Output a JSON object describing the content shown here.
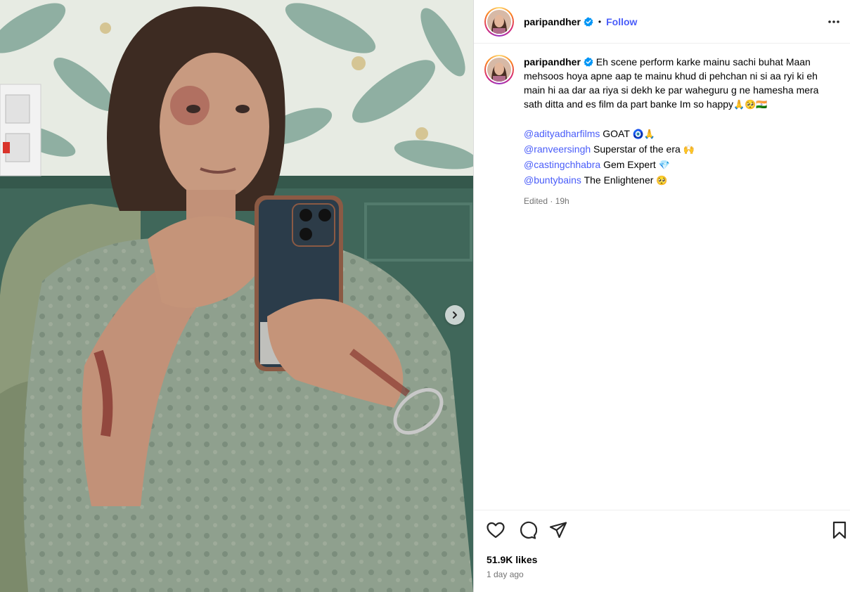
{
  "post": {
    "username": "paripandher",
    "follow_label": "Follow",
    "separator": "•",
    "caption_text": "Eh scene perform karke mainu sachi buhat Maan mehsoos hoya apne aap te mainu khud di pehchan ni si aa ryi ki eh main hi aa dar aa riya si dekh ke par waheguru g ne hamesha mera sath ditta and es film da part banke Im so happy",
    "caption_emoji": "🙏🥺🇮🇳",
    "mentions": [
      {
        "handle": "@adityadharfilms",
        "text": "GOAT",
        "emoji": "🧿🙏"
      },
      {
        "handle": "@ranveersingh",
        "text": "Superstar of the era",
        "emoji": "🙌"
      },
      {
        "handle": "@castingchhabra",
        "text": "Gem Expert",
        "emoji": "💎"
      },
      {
        "handle": "@buntybains",
        "text": "The Enlightener",
        "emoji": "🥺"
      }
    ],
    "meta": "Edited · 19h",
    "likes": "51.9K likes",
    "posted": "1 day ago"
  },
  "icons": {
    "verified": "verified-badge-icon",
    "more": "more-options-icon",
    "like": "heart-icon",
    "comment": "comment-icon",
    "share": "share-icon",
    "save": "bookmark-icon",
    "next": "chevron-right-icon"
  },
  "colors": {
    "link": "#4a5df9",
    "verified": "#0095f6",
    "secondary_text": "#737373",
    "divider": "#dbdbdb"
  }
}
